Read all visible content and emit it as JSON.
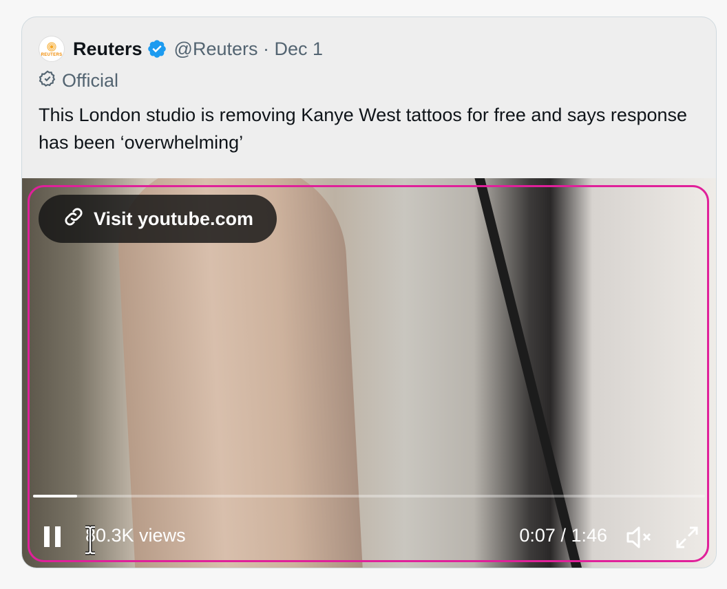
{
  "tweet": {
    "avatar_label": "REUTERS",
    "name": "Reuters",
    "handle_date": "@Reuters · Dec 1",
    "official_label": "Official",
    "text": "This London studio is removing Kanye West tattoos for free and says response has been ‘overwhelming’"
  },
  "video": {
    "visit_label": "Visit youtube.com",
    "views": "80.3K views",
    "time": "0:07 / 1:46",
    "progress": 0.066
  },
  "icons": {
    "verified": "verified-badge-icon",
    "official": "official-badge-icon",
    "link": "link-icon",
    "pause": "pause-icon",
    "mute": "mute-icon",
    "fullscreen": "fullscreen-icon"
  },
  "colors": {
    "verified": "#1d9bf0",
    "highlight": "#e0209a"
  }
}
